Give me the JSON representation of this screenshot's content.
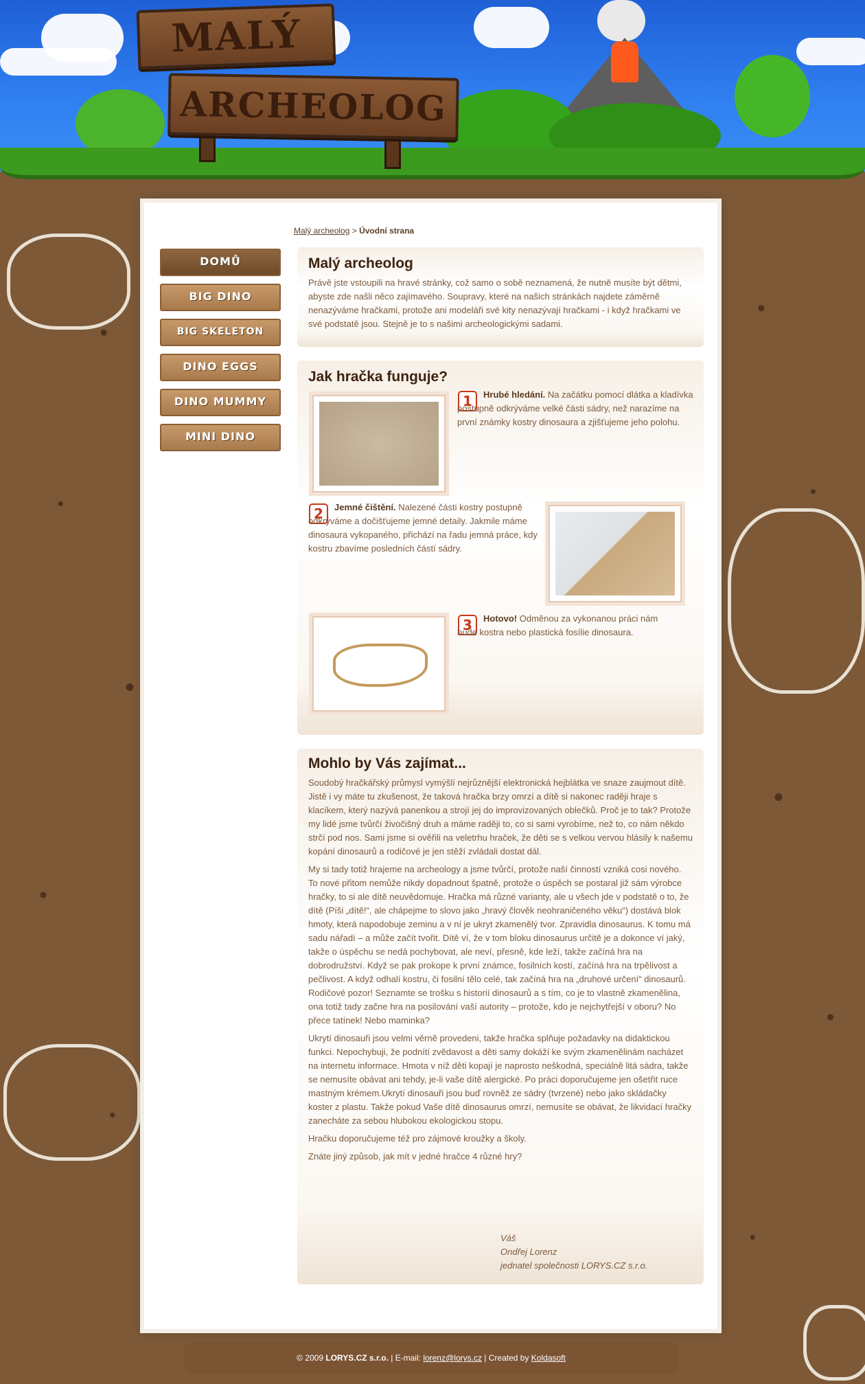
{
  "logo": {
    "line1": "MALÝ",
    "line2": "ARCHEOLOG"
  },
  "breadcrumb": {
    "home": "Malý archeolog",
    "separator": ">",
    "current": "Úvodní strana"
  },
  "menu": {
    "items": [
      {
        "label": "DOMŮ"
      },
      {
        "label": "BIG DINO"
      },
      {
        "label": "BIG SKELETON"
      },
      {
        "label": "DINO EGGS"
      },
      {
        "label": "DINO MUMMY"
      },
      {
        "label": "MINI DINO"
      }
    ]
  },
  "intro": {
    "title": "Malý archeolog",
    "text": "Právě jste vstoupili na hravé stránky, což samo o sobě neznamená, že nutně musíte být dětmi, abyste zde našli něco zajímavého. Soupravy, které na našich stránkách najdete záměrně nenazýváme hračkami, protože ani modeláři své kity nenazývají hračkami - i když hračkami ve své podstatě jsou. Stejně je to s našimi archeologickými sadami."
  },
  "how": {
    "title": "Jak hračka funguje?",
    "steps": [
      {
        "num": "1",
        "head": "Hrubé hledání.",
        "text": " Na začátku pomocí dlátka a kladívka postupně odkrýváme velké části sádry, než narazíme na první známky kostry dinosaura a zjišťujeme jeho polohu."
      },
      {
        "num": "2",
        "head": "Jemné čištění.",
        "text": " Nalezené části kostry postupně odkrýváme a dočišťujeme jemné detaily. Jakmile máme dinosaura vykopaného, přichází na řadu jemná práce, kdy kostru zbavíme posledních částí sádry."
      },
      {
        "num": "3",
        "head": "Hotovo!",
        "text": " Odměnou za vykonanou práci nám bude kostra nebo plastická fosílie dinosaura."
      }
    ]
  },
  "more": {
    "title": "Mohlo by Vás zajímat...",
    "p1": "Soudobý hračkářský průmysl vymýšlí nejrůznější elektronická hejblátka ve snaze zaujmout dítě. Jistě i vy máte tu zkušenost, že taková hračka brzy omrzí a dítě si nakonec raději hraje s klacíkem, který nazývá panenkou a strojí jej do improvizovaných oblečků. Proč je to tak? Protože my lidé jsme tvůrčí živočišný druh a máme raději to, co si sami vyrobíme, než to, co nám někdo strčí pod nos. Sami jsme si ověřili na veletrhu hraček, že děti se s velkou vervou hlásily k našemu kopání dinosaurů a rodičové je jen stěží zvládali dostat dál.",
    "p2": "My si tady totiž hrajeme na archeology a jsme tvůrčí, protože naší činností vzniká cosi nového. To nové přitom nemůže nikdy dopadnout špatně, protože o úspěch se postaral již sám výrobce hračky, to si ale dítě neuvědomuje. Hračka má různé varianty, ale u všech jde v podstatě o to, že dítě (Píši „dítě!“, ale chápejme to slovo jako „hravý člověk neohraničeného věku“) dostává blok hmoty, která napodobuje zeminu a v ní je ukryt zkamenělý tvor. Zpravidla dinosaurus. K tomu má sadu nářadí – a může začít tvořit. Dítě ví, že v tom bloku dinosaurus určitě je a dokonce ví jaký, takže o úspěchu se nedá pochybovat, ale neví, přesně, kde leží, takže začíná hra na dobrodružství. Když se pak prokope k první známce, fosilních kostí, začíná hra na trpělivost a pečlivost. A když odhalí kostru, či fosilní tělo celé, tak začíná hra na „druhové určení“ dinosaurů. Rodičové pozor! Seznamte se trošku s historií dinosaurů a s tím, co je to vlastně zkamenělina, ona totiž tady začne hra na posilování vaší autority – protože, kdo je nejchytřejší v oboru? No přece tatínek! Nebo maminka?",
    "p3": "Ukrytí dinosauři jsou velmi věrně provedeni, takže hračka splňuje požadavky na didaktickou funkci. Nepochybuji, že podnítí zvědavost a děti samy dokáží ke svým zkamenělinám nacházet na internetu informace. Hmota v níž děti kopají je naprosto neškodná, speciálně litá sádra, takže se nemusíte obávat ani tehdy, je-li vaše dítě alergické. Po práci doporučujeme jen ošetřit ruce mastným krémem.Ukrytí dinosauři jsou buď rovněž ze sádry (tvrzené) nebo jako skládačky koster z plastu. Takže pokud Vaše dítě dinosaurus omrzí, nemusíte se obávat, že likvidací hračky zanecháte za sebou hlubokou ekologickou stopu.",
    "p4": "Hračku doporučujeme též pro zájmové kroužky a školy.",
    "p5": "Znáte jiný způsob, jak mít v jedné hračce 4 různé hry?"
  },
  "signature": {
    "l1": "Váš",
    "l2": "Ondřej Lorenz",
    "l3": "jednatel společnosti LORYS.CZ s.r.o."
  },
  "footer": {
    "copyright": "© 2009",
    "company": "LORYS.CZ s.r.o.",
    "email_label": " | E-mail: ",
    "email": "lorenz@lorys.cz",
    "created_label": " | Created by ",
    "creator": "Koldasoft"
  },
  "colors": {
    "brown": "#7d5938",
    "heading": "#3d2210",
    "text": "#7b5a3c",
    "sky": "#2f7ef0",
    "grass": "#3c9a1e"
  }
}
